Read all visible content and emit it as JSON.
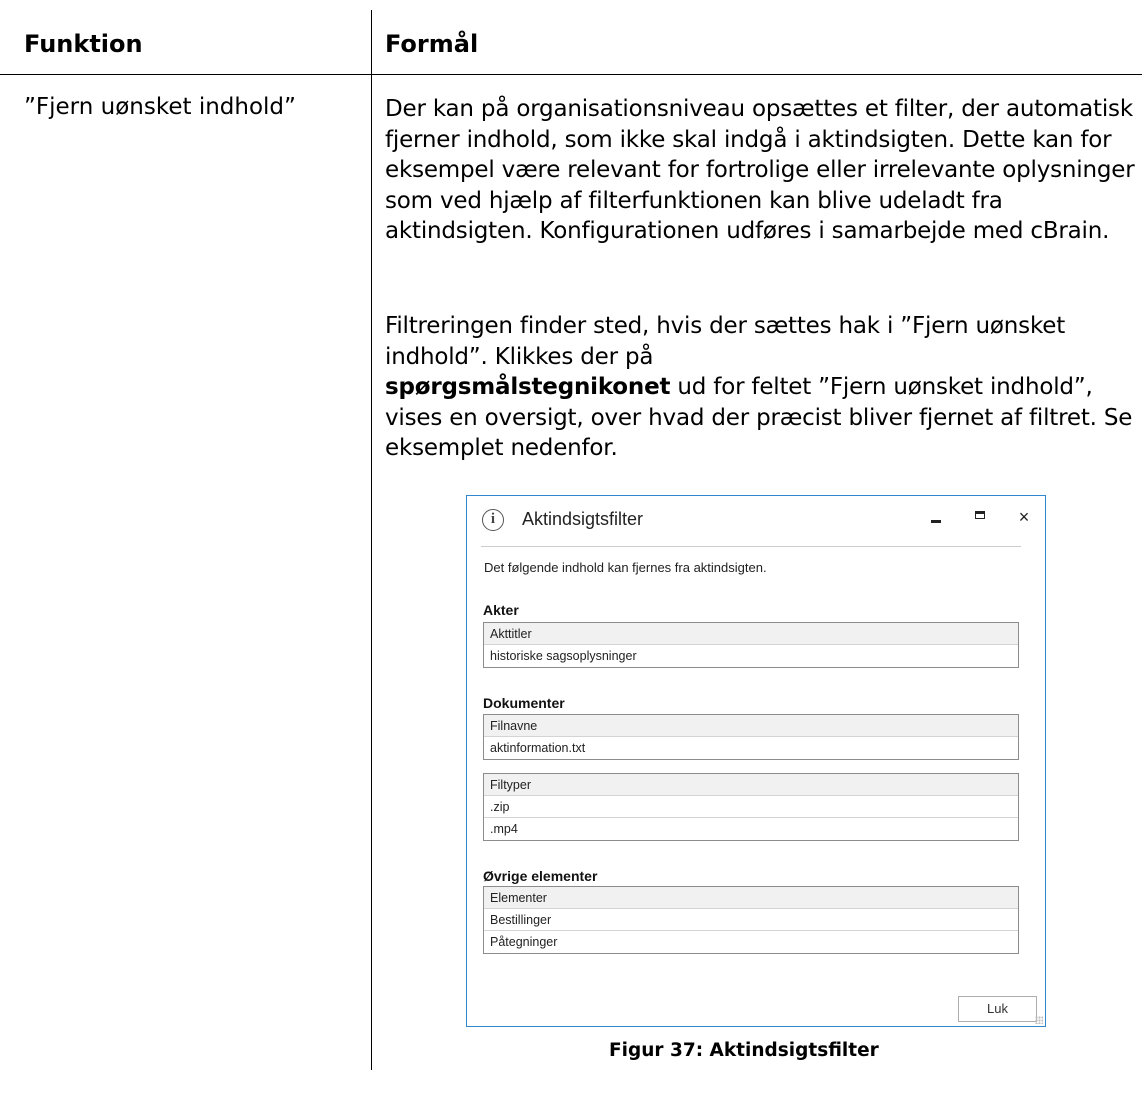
{
  "table": {
    "col_funktion": "Funktion",
    "col_formaal": "Formål",
    "row": {
      "funktion": "”Fjern uønsket indhold”",
      "p1": "Der kan på organisationsniveau opsættes et filter, der automatisk fjerner  indhold, som ikke skal indgå i aktindsigten. Dette kan for eksempel være relevant for fortrolige eller irrelevante oplysninger som ved hjælp af filterfunktionen kan blive udeladt fra aktindsigten. Konfigurationen udføres i samarbejde med cBrain.",
      "p2_a": "Filtreringen finder sted, hvis der sættes hak i ”Fjern uønsket indhold”. Klikkes der på",
      "p2_bold": "spørgsmålstegnikonet",
      "p2_b": "ud for feltet ”Fjern uønsket indhold”, vises en oversigt, over hvad der præcist bliver fjernet af filtret. Se eksemplet nedenfor."
    }
  },
  "dialog": {
    "title": "Aktindsigtsfilter",
    "info_icon_glyph": "i",
    "close_glyph": "×",
    "description": "Det følgende indhold kan fjernes fra aktindsigten.",
    "sections": [
      {
        "heading": "Akter",
        "boxes": [
          [
            "Akttitler",
            "historiske sagsoplysninger"
          ]
        ]
      },
      {
        "heading": "Dokumenter",
        "boxes": [
          [
            "Filnavne",
            "aktinformation.txt"
          ],
          [
            "Filtyper",
            ".zip",
            ".mp4"
          ]
        ]
      },
      {
        "heading": "Øvrige elementer",
        "boxes": [
          [
            "Elementer",
            "Bestillinger",
            "Påtegninger"
          ]
        ]
      }
    ],
    "close_button": "Luk"
  },
  "caption": "Figur  37: Aktindsigtsfilter",
  "colors": {
    "dialog_border": "#2f86d1",
    "row_header_bg": "#f1f1f1"
  }
}
